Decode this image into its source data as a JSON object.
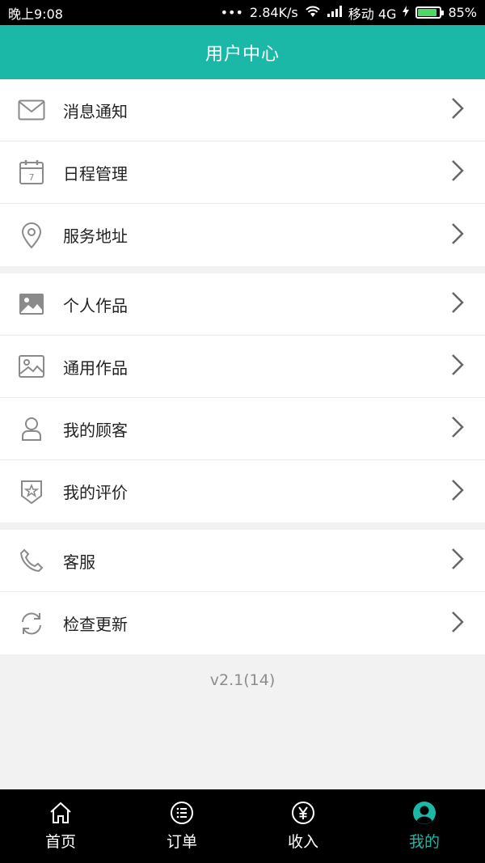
{
  "status_bar": {
    "time": "晚上9:08",
    "dots": "•••",
    "speed": "2.84K/s",
    "carrier": "移动 4G",
    "battery": "85%",
    "battery_level": 0.85
  },
  "header": {
    "title": "用户中心"
  },
  "groups": [
    {
      "items": [
        {
          "label": "消息通知",
          "icon": "envelope-icon"
        },
        {
          "label": "日程管理",
          "icon": "calendar-icon"
        },
        {
          "label": "服务地址",
          "icon": "location-pin-icon"
        }
      ]
    },
    {
      "items": [
        {
          "label": "个人作品",
          "icon": "image-filled-icon"
        },
        {
          "label": "通用作品",
          "icon": "image-outline-icon"
        },
        {
          "label": "我的顾客",
          "icon": "person-icon"
        },
        {
          "label": "我的评价",
          "icon": "star-shield-icon"
        }
      ]
    },
    {
      "items": [
        {
          "label": "客服",
          "icon": "phone-icon"
        },
        {
          "label": "检查更新",
          "icon": "refresh-icon"
        }
      ]
    }
  ],
  "version": "v2.1(14)",
  "tabs": [
    {
      "label": "首页",
      "icon": "home-icon",
      "active": false
    },
    {
      "label": "订单",
      "icon": "list-icon",
      "active": false
    },
    {
      "label": "收入",
      "icon": "yen-icon",
      "active": false
    },
    {
      "label": "我的",
      "icon": "profile-icon",
      "active": true
    }
  ],
  "colors": {
    "accent": "#1bb8a7",
    "icon_gray": "#8a8a8a"
  }
}
